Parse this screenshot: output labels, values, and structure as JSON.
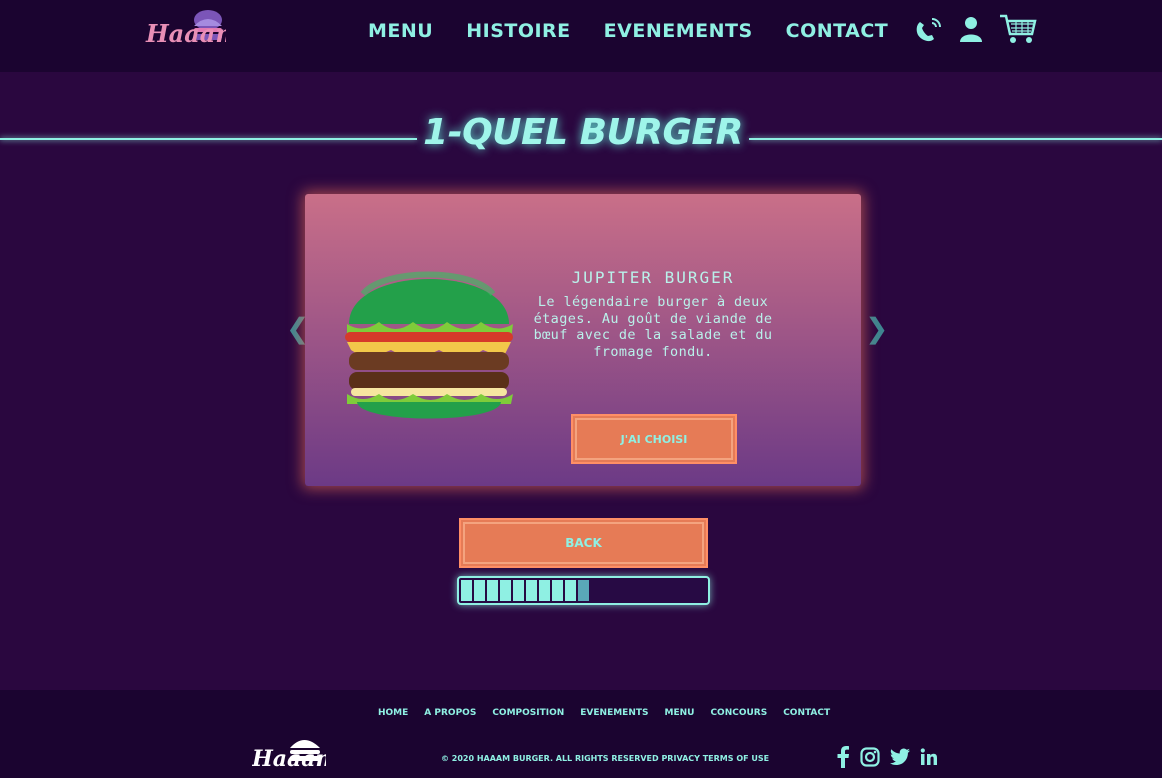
{
  "header": {
    "logo_text": "Haaam",
    "nav": [
      "MENU",
      "HISTOIRE",
      "EVENEMENTS",
      "CONTACT"
    ],
    "icons": [
      "phone-icon",
      "user-icon",
      "cart-icon"
    ]
  },
  "main": {
    "title": "1-QUEL BURGER",
    "card": {
      "name": "JUPITER BURGER",
      "description": "Le légendaire burger à deux étages. Au goût de viande de bœuf avec de la salade et du fromage fondu.",
      "choose_label": "J'AI CHOISI"
    },
    "back_label": "BACK",
    "progress": {
      "filled_segments": 9,
      "total_segments": 20,
      "percent": 48
    }
  },
  "footer": {
    "nav": [
      "HOME",
      "A PROPOS",
      "COMPOSITION",
      "EVENEMENTS",
      "MENU",
      "CONCOURS",
      "CONTACT"
    ],
    "copyright": "© 2020 HAAAM BURGER. ALL RIGHTS RESERVED PRIVACY TERMS OF USE",
    "logo_text": "Haaam",
    "social": [
      "facebook-icon",
      "instagram-icon",
      "twitter-icon",
      "linkedin-icon"
    ]
  },
  "colors": {
    "background": "#2a073f",
    "header": "#1b0430",
    "accent": "#8ff0e3",
    "button": "#e67b56"
  }
}
